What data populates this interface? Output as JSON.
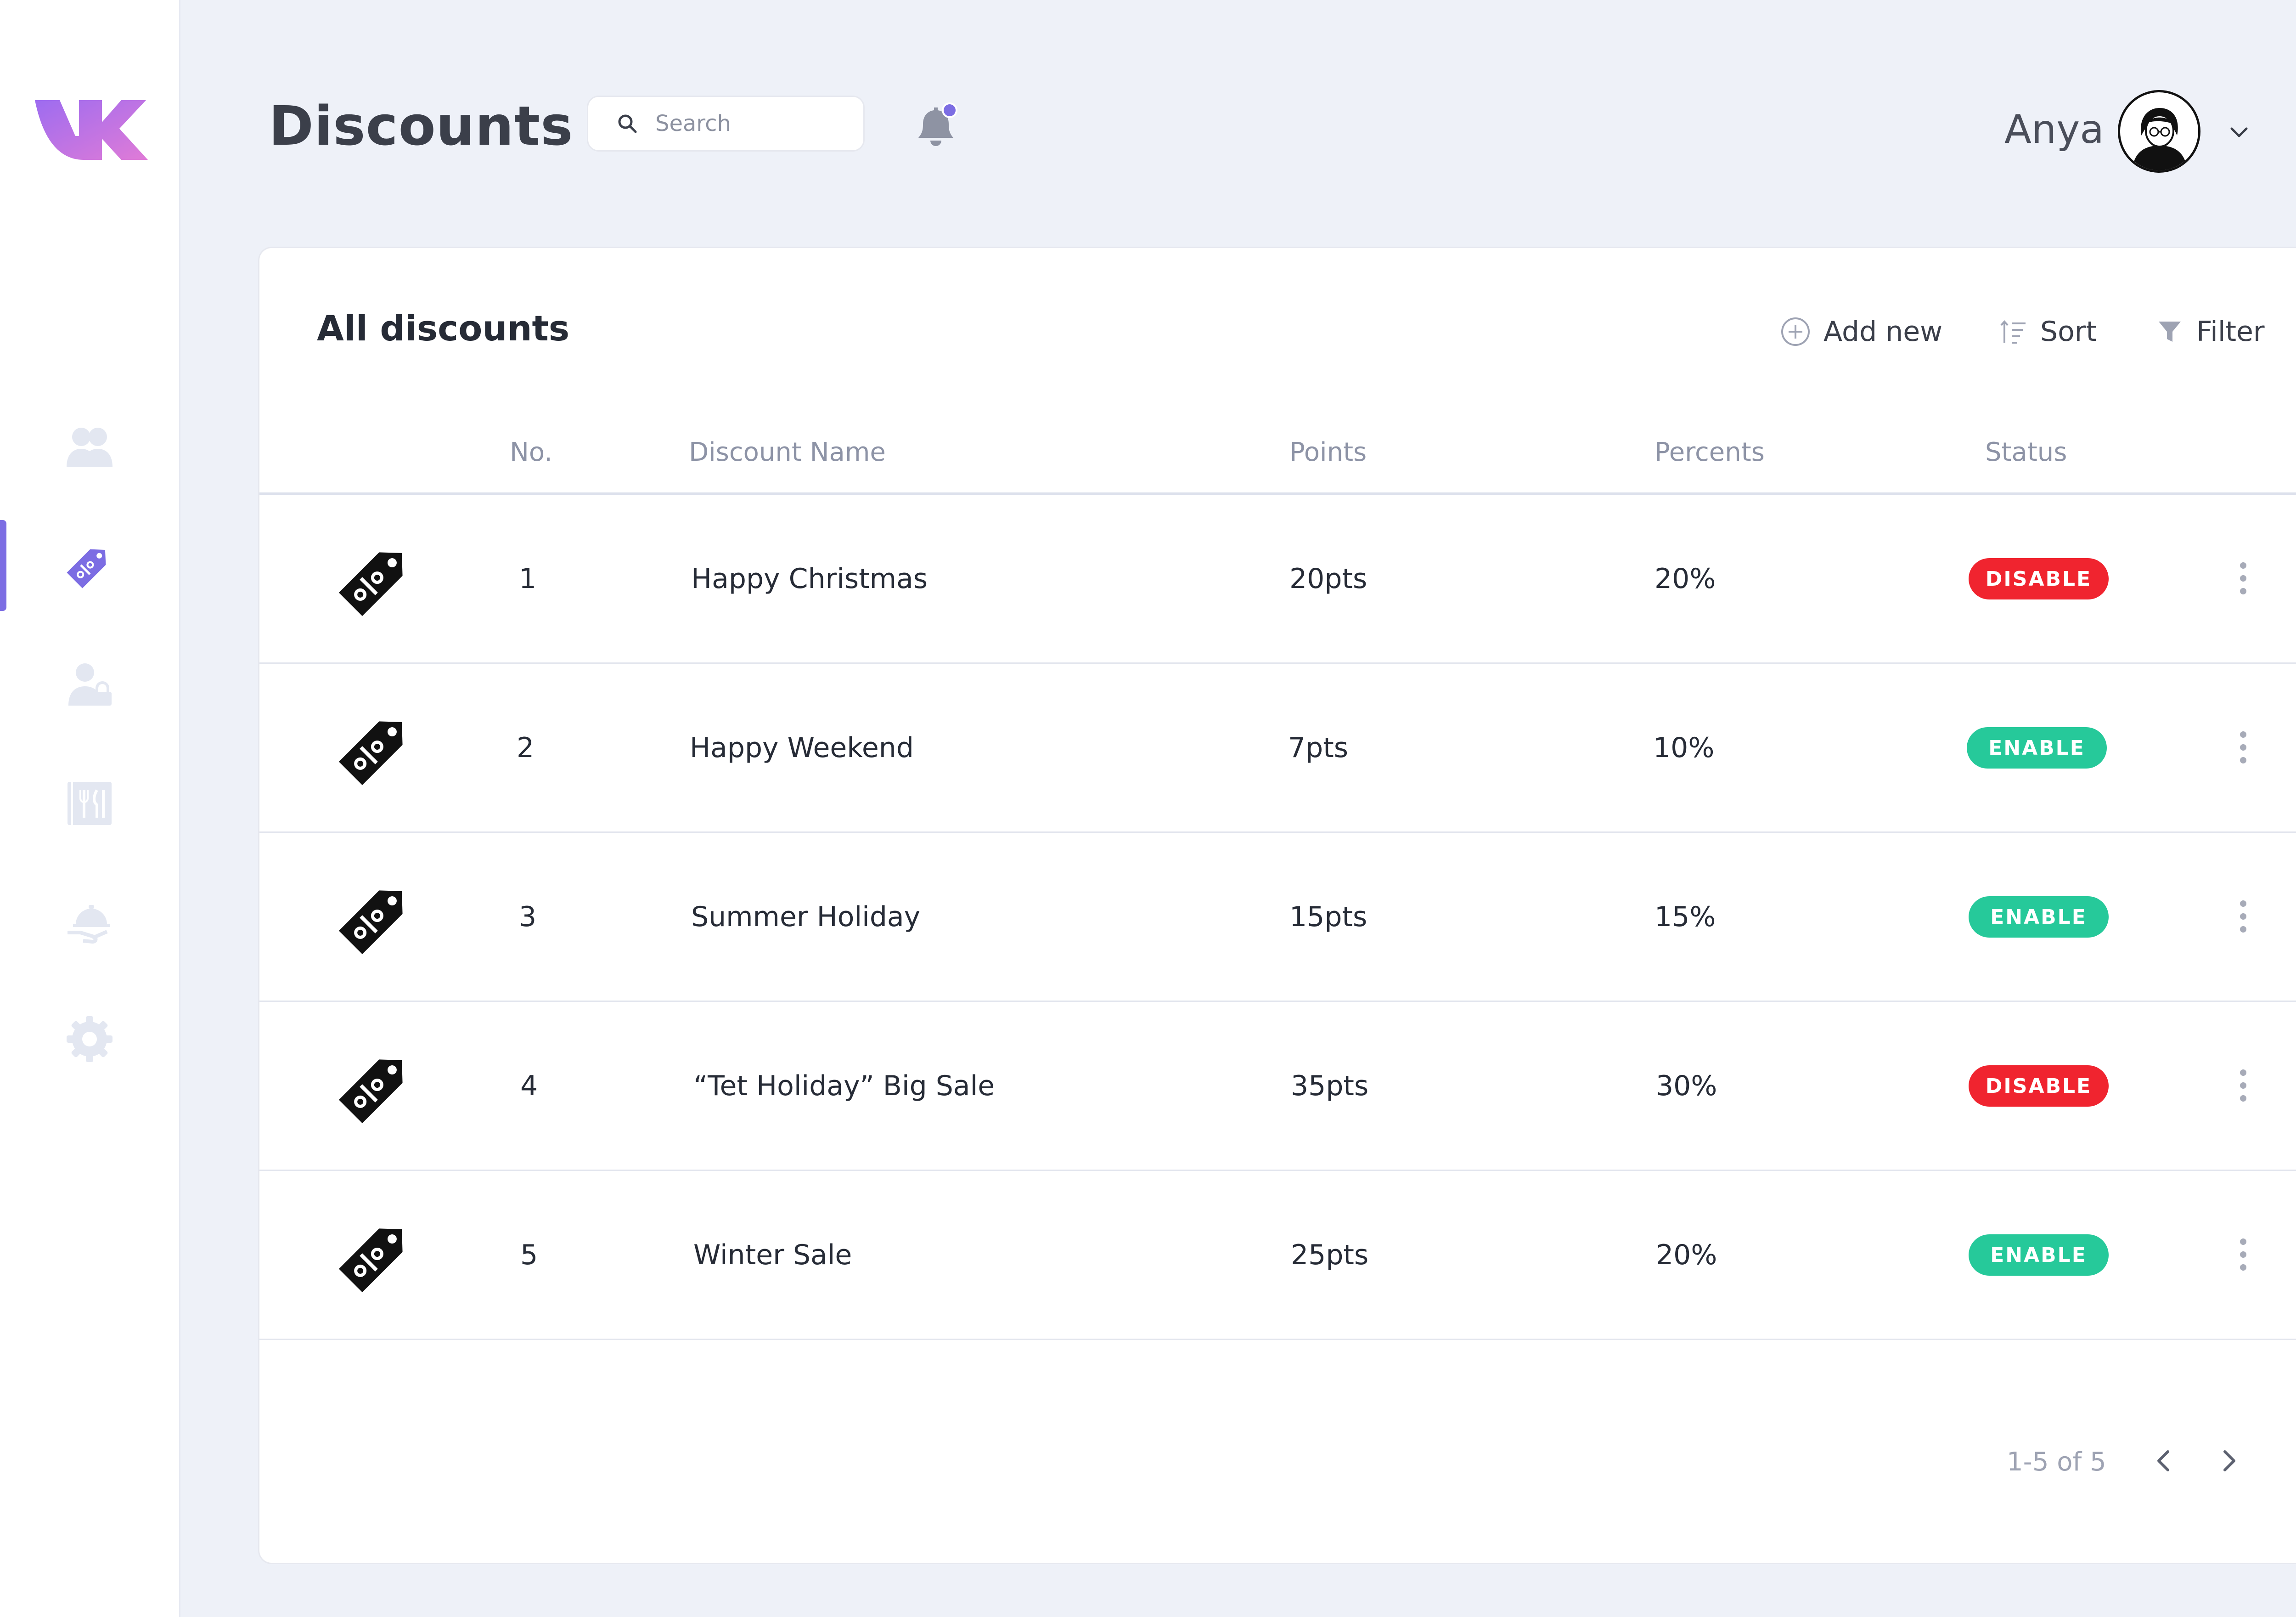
{
  "header": {
    "title": "Discounts",
    "search_placeholder": "Search",
    "user_name": "Anya"
  },
  "sidebar": {
    "items": [
      {
        "icon": "users-icon",
        "active": false
      },
      {
        "icon": "discount-tag-icon",
        "active": true
      },
      {
        "icon": "user-lock-icon",
        "active": false
      },
      {
        "icon": "restaurant-menu-icon",
        "active": false
      },
      {
        "icon": "food-serving-icon",
        "active": false
      },
      {
        "icon": "gear-icon",
        "active": false
      }
    ]
  },
  "card": {
    "title": "All discounts",
    "actions": {
      "add_new": "Add new",
      "sort": "Sort",
      "filter": "Filter"
    },
    "columns": [
      "No.",
      "Discount Name",
      "Points",
      "Percents",
      "Status"
    ],
    "rows": [
      {
        "no": "1",
        "name": "Happy Christmas",
        "points": "20pts",
        "percents": "20%",
        "status": "DISABLE"
      },
      {
        "no": "2",
        "name": "Happy Weekend",
        "points": "7pts",
        "percents": "10%",
        "status": "ENABLE"
      },
      {
        "no": "3",
        "name": "Summer Holiday",
        "points": "15pts",
        "percents": "15%",
        "status": "ENABLE"
      },
      {
        "no": "4",
        "name": "“Tet Holiday” Big Sale",
        "points": "35pts",
        "percents": "30%",
        "status": "DISABLE"
      },
      {
        "no": "5",
        "name": "Winter Sale",
        "points": "25pts",
        "percents": "20%",
        "status": "ENABLE"
      }
    ],
    "pagination": "1-5 of 5"
  },
  "colors": {
    "accent": "#7c6de3",
    "background": "#eef1f8",
    "disable": "#f0242f",
    "enable": "#26c99a",
    "sidebar_icon": "#e3e7f1",
    "notification_dot": "#7c6de3"
  }
}
